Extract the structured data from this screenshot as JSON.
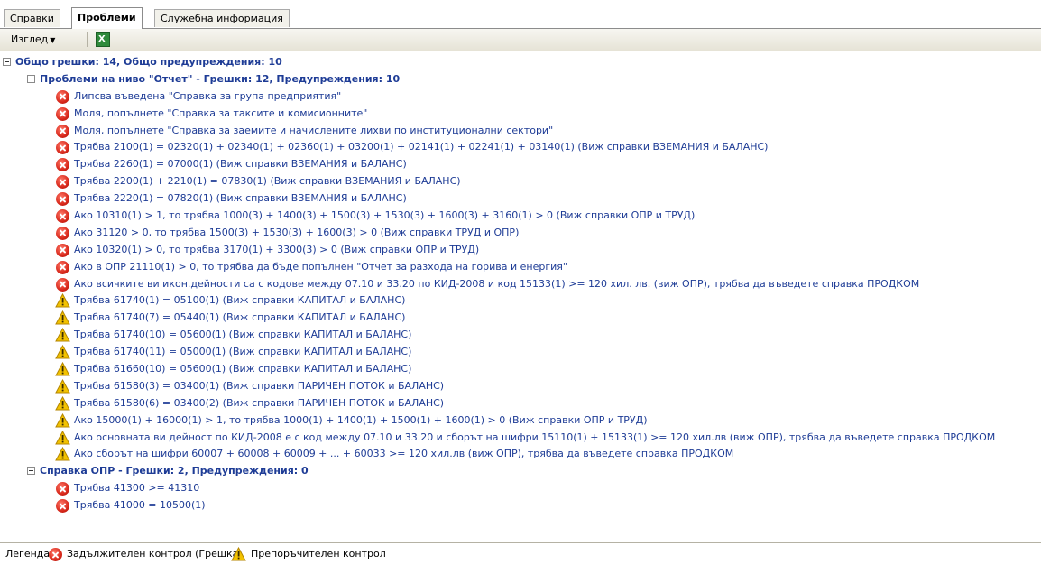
{
  "tabs": [
    {
      "label": "Справки",
      "active": false
    },
    {
      "label": "Проблеми",
      "active": true
    },
    {
      "label": "Служебна информация",
      "active": false
    }
  ],
  "toolbar": {
    "view_label": "Изглед",
    "excel_icon": "excel-export-icon"
  },
  "tree": {
    "root": "Общо грешки: 14, Общо предупреждения: 10",
    "groups": [
      {
        "label": "Проблеми на ниво \"Отчет\" - Грешки: 12, Предупреждения: 10",
        "items": [
          {
            "type": "error",
            "text": "Липсва въведена \"Справка за група предприятия\""
          },
          {
            "type": "error",
            "text": "Моля, попълнете \"Справка за таксите и комисионните\""
          },
          {
            "type": "error",
            "text": "Моля, попълнете \"Справка за заемите и начислените лихви по институционални сектори\""
          },
          {
            "type": "error",
            "text": "Трябва 2100(1) = 02320(1) + 02340(1) + 02360(1) + 03200(1) + 02141(1) + 02241(1) + 03140(1) (Виж справки ВЗЕМАНИЯ и БАЛАНС)"
          },
          {
            "type": "error",
            "text": "Трябва 2260(1) = 07000(1) (Виж справки ВЗЕМАНИЯ и БАЛАНС)"
          },
          {
            "type": "error",
            "text": "Трябва 2200(1) + 2210(1) = 07830(1) (Виж справки ВЗЕМАНИЯ и БАЛАНС)"
          },
          {
            "type": "error",
            "text": "Трябва 2220(1) = 07820(1) (Виж справки ВЗЕМАНИЯ и БАЛАНС)"
          },
          {
            "type": "error",
            "text": "Ако 10310(1) > 1, то трябва 1000(3) + 1400(3) + 1500(3) + 1530(3) + 1600(3) + 3160(1) > 0 (Виж справки ОПР и ТРУД)"
          },
          {
            "type": "error",
            "text": "Ако 31120 > 0, то трябва 1500(3) + 1530(3) + 1600(3) > 0 (Виж справки ТРУД и ОПР)"
          },
          {
            "type": "error",
            "text": "Ако 10320(1) > 0, то трябва 3170(1) + 3300(3) > 0 (Виж справки ОПР и ТРУД)"
          },
          {
            "type": "error",
            "text": "Ако в ОПР 21110(1) > 0, то трябва да бъде попълнен \"Отчет за разхода на горива и енергия\""
          },
          {
            "type": "error",
            "text": "Ако всичките ви икон.дейности са с кодове между 07.10 и 33.20 по КИД-2008 и код 15133(1) >= 120 хил. лв. (виж ОПР), трябва да въведете справка ПРОДКОМ"
          },
          {
            "type": "warning",
            "text": "Трябва 61740(1) = 05100(1) (Виж справки КАПИТАЛ и БАЛАНС)"
          },
          {
            "type": "warning",
            "text": "Трябва 61740(7) = 05440(1) (Виж справки КАПИТАЛ и БАЛАНС)"
          },
          {
            "type": "warning",
            "text": "Трябва 61740(10) = 05600(1) (Виж справки КАПИТАЛ и БАЛАНС)"
          },
          {
            "type": "warning",
            "text": "Трябва 61740(11) = 05000(1) (Виж справки КАПИТАЛ и БАЛАНС)"
          },
          {
            "type": "warning",
            "text": "Трябва 61660(10) = 05600(1) (Виж справки КАПИТАЛ и БАЛАНС)"
          },
          {
            "type": "warning",
            "text": "Трябва 61580(3) = 03400(1) (Виж справки ПАРИЧЕН ПОТОК и БАЛАНС)"
          },
          {
            "type": "warning",
            "text": "Трябва 61580(6) = 03400(2) (Виж справки ПАРИЧЕН ПОТОК и БАЛАНС)"
          },
          {
            "type": "warning",
            "text": "Ако 15000(1) + 16000(1) > 1, то трябва 1000(1) + 1400(1) + 1500(1) + 1600(1) > 0 (Виж справки ОПР и ТРУД)"
          },
          {
            "type": "warning",
            "text": "Ако основната ви дейност по КИД-2008 е с код между 07.10 и 33.20 и сборът на шифри 15110(1) + 15133(1) >= 120 хил.лв (виж ОПР), трябва да въведете справка ПРОДКОМ"
          },
          {
            "type": "warning",
            "text": "Ако сборът на шифри 60007 + 60008 + 60009 + ... + 60033 >= 120 хил.лв (виж ОПР), трябва да въведете справка ПРОДКОМ"
          }
        ]
      },
      {
        "label": "Справка ОПР - Грешки: 2, Предупреждения: 0",
        "items": [
          {
            "type": "error",
            "text": "Трябва 41300 >= 41310"
          },
          {
            "type": "error",
            "text": "Трябва 41000 = 10500(1)"
          }
        ]
      }
    ]
  },
  "legend": {
    "label": "Легенда:",
    "error_label": "Задължителен контрол (Грешка)",
    "warning_label": "Препоръчителен контрол"
  },
  "colors": {
    "text": "#1e3c96",
    "error": "#d8281b",
    "warning": "#f2c200"
  }
}
